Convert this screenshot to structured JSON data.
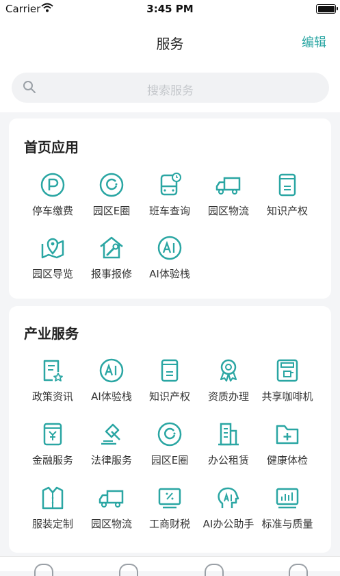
{
  "status": {
    "carrier": "Carrier",
    "time": "3:45 PM"
  },
  "header": {
    "title": "服务",
    "edit_label": "编辑"
  },
  "search": {
    "placeholder": "搜索服务"
  },
  "colors": {
    "accent": "#2aa6a3",
    "background": "#f4f5f7"
  },
  "sections": [
    {
      "title": "首页应用",
      "items": [
        {
          "label": "停车缴费",
          "icon": "parking-icon"
        },
        {
          "label": "园区E圈",
          "icon": "e-circle-icon"
        },
        {
          "label": "班车查询",
          "icon": "bus-icon"
        },
        {
          "label": "园区物流",
          "icon": "truck-icon"
        },
        {
          "label": "知识产权",
          "icon": "book-icon"
        },
        {
          "label": "园区导览",
          "icon": "map-pin-icon"
        },
        {
          "label": "报事报修",
          "icon": "repair-house-icon"
        },
        {
          "label": "AI体验栈",
          "icon": "ai-circle-icon"
        }
      ]
    },
    {
      "title": "产业服务",
      "items": [
        {
          "label": "政策资讯",
          "icon": "policy-doc-icon"
        },
        {
          "label": "AI体验栈",
          "icon": "ai-circle-icon"
        },
        {
          "label": "知识产权",
          "icon": "book-icon"
        },
        {
          "label": "资质办理",
          "icon": "award-icon"
        },
        {
          "label": "共享咖啡机",
          "icon": "coffee-machine-icon"
        },
        {
          "label": "金融服务",
          "icon": "finance-icon"
        },
        {
          "label": "法律服务",
          "icon": "gavel-icon"
        },
        {
          "label": "园区E圈",
          "icon": "e-circle-icon"
        },
        {
          "label": "办公租赁",
          "icon": "building-icon"
        },
        {
          "label": "健康体检",
          "icon": "health-folder-icon"
        },
        {
          "label": "服装定制",
          "icon": "shirt-icon"
        },
        {
          "label": "园区物流",
          "icon": "truck-icon"
        },
        {
          "label": "工商财税",
          "icon": "tax-icon"
        },
        {
          "label": "AI办公助手",
          "icon": "ai-head-icon"
        },
        {
          "label": "标准与质量",
          "icon": "standard-chart-icon"
        }
      ]
    }
  ]
}
